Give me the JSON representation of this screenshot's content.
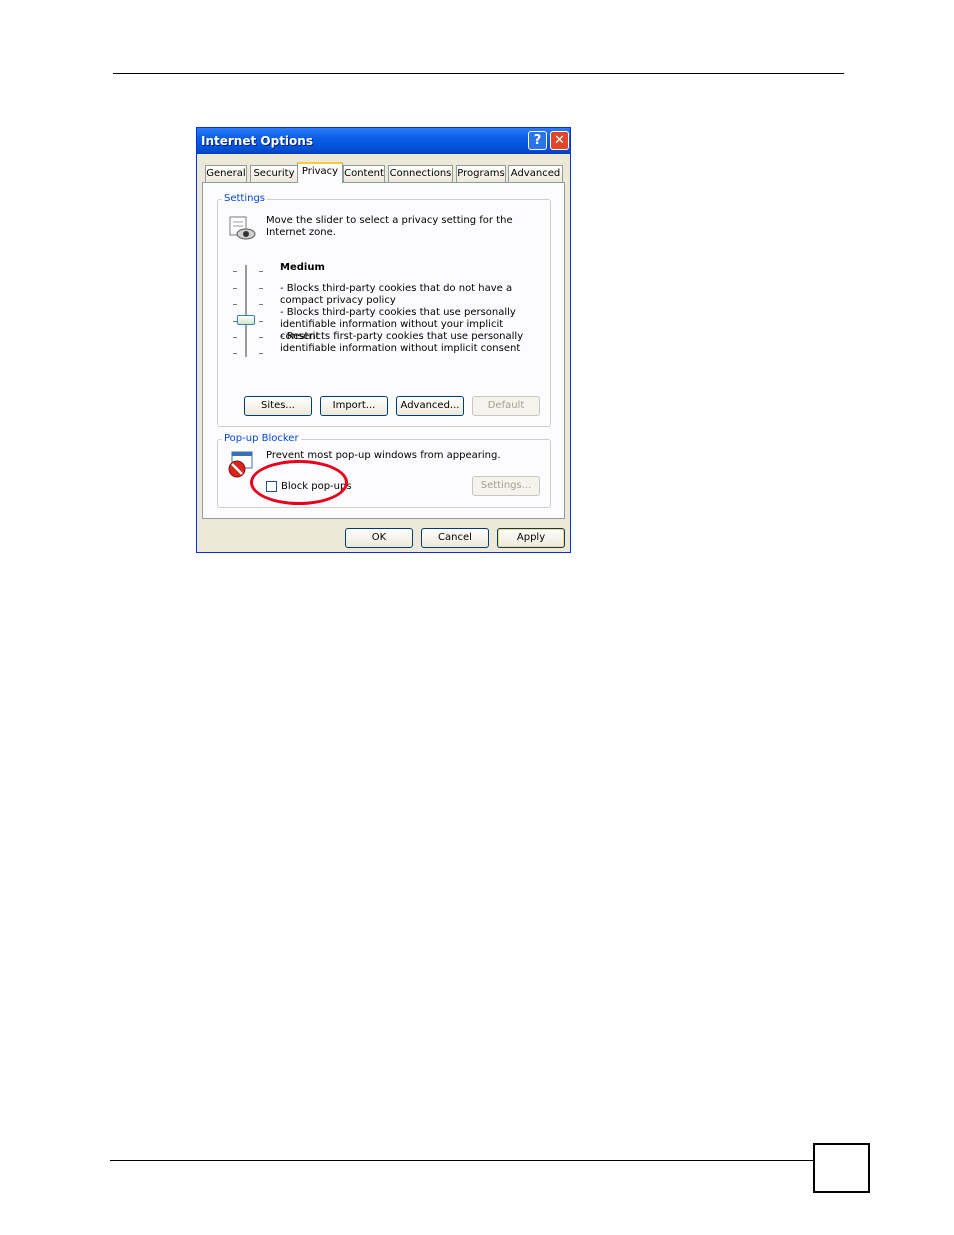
{
  "dialog": {
    "title": "Internet Options",
    "help_glyph": "?",
    "close_glyph": "✕"
  },
  "tabs": [
    {
      "label": "General"
    },
    {
      "label": "Security"
    },
    {
      "label": "Privacy"
    },
    {
      "label": "Content"
    },
    {
      "label": "Connections"
    },
    {
      "label": "Programs"
    },
    {
      "label": "Advanced"
    }
  ],
  "active_tab": "Privacy",
  "settings": {
    "group_label": "Settings",
    "intro": "Move the slider to select a privacy setting for the Internet zone.",
    "level_title": "Medium",
    "descriptions": [
      "- Blocks third-party cookies that do not have a compact privacy policy",
      "- Blocks third-party cookies that use personally identifiable information without your implicit consent",
      "- Restricts first-party cookies that use personally identifiable information without implicit consent"
    ],
    "buttons": {
      "sites": "Sites...",
      "import": "Import...",
      "advanced": "Advanced...",
      "default": "Default"
    }
  },
  "popup_blocker": {
    "group_label": "Pop-up Blocker",
    "description": "Prevent most pop-up windows from appearing.",
    "checkbox_label": "Block pop-ups",
    "checked": false,
    "settings_button": "Settings..."
  },
  "footer": {
    "ok": "OK",
    "cancel": "Cancel",
    "apply": "Apply"
  },
  "colors": {
    "titlebar": "#0350d8",
    "group_label": "#0046d5",
    "annotation": "#e8001c"
  }
}
